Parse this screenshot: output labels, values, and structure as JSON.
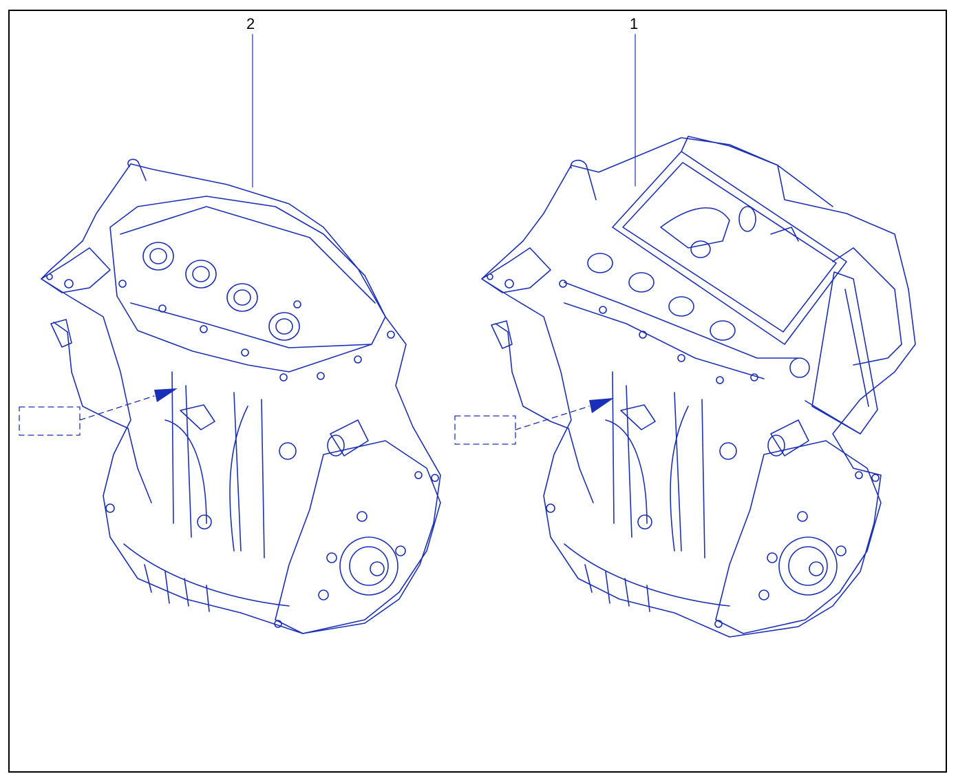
{
  "callouts": [
    {
      "id": "2",
      "label": "2"
    },
    {
      "id": "1",
      "label": "1"
    }
  ],
  "colors": {
    "line_art": "#1a2fb8",
    "frame": "#000000",
    "background": "#ffffff"
  },
  "figures": [
    {
      "name": "engine-assembly-with-valve-cover",
      "callout": "2"
    },
    {
      "name": "engine-assembly-with-air-box",
      "callout": "1"
    }
  ]
}
